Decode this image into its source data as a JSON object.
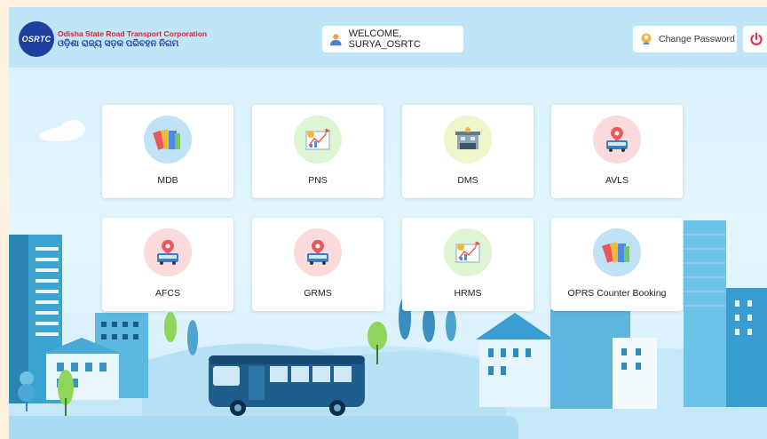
{
  "header": {
    "logo_badge": "OSRTC",
    "org_name_en": "Odisha State Road Transport Corporation",
    "org_name_or": "ଓଡ଼ିଶା ରାଜ୍ୟ ସଡ଼କ ପରିବହନ ନିଗମ",
    "welcome_text": "WELCOME, SURYA_OSRTC",
    "change_password_label": "Change Password"
  },
  "modules": [
    {
      "label": "MDB",
      "icon": "books-icon"
    },
    {
      "label": "PNS",
      "icon": "chart-board-icon"
    },
    {
      "label": "DMS",
      "icon": "depot-building-icon"
    },
    {
      "label": "AVLS",
      "icon": "bus-location-icon"
    },
    {
      "label": "AFCS",
      "icon": "bus-location-icon"
    },
    {
      "label": "GRMS",
      "icon": "bus-location-icon"
    },
    {
      "label": "HRMS",
      "icon": "chart-board-icon"
    },
    {
      "label": "OPRS Counter Booking",
      "icon": "books-icon"
    }
  ],
  "colors": {
    "brand_blue": "#1e3f9e",
    "brand_red": "#d8262f",
    "header_bg": "#bfe6f7",
    "logout_red": "#e3344d"
  }
}
